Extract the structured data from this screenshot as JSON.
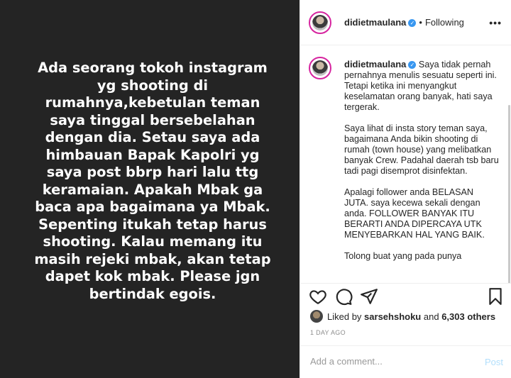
{
  "post": {
    "image_text": "Ada seorang tokoh instagram yg shooting di rumahnya,kebetulan teman saya tinggal bersebelahan dengan dia. Setau saya ada himbauan Bapak Kapolri yg saya post bbrp hari lalu ttg keramaian. Apakah Mbak ga baca apa bagaimana ya Mbak. Sepenting itukah tetap harus shooting. Kalau memang itu masih rejeki mbak, akan tetap dapet kok mbak. Please jgn bertindak egois."
  },
  "header": {
    "username": "didietmaulana",
    "separator": "•",
    "follow_status": "Following",
    "more_icon": "more-horizontal-icon"
  },
  "caption": {
    "username": "didietmaulana",
    "paragraph1": "Saya tidak pernah pernahnya menulis sesuatu seperti ini. Tetapi ketika ini menyangkut keselamatan orang banyak, hati saya tergerak.",
    "paragraph2": "Saya lihat di insta story teman saya, bagaimana Anda bikin shooting di rumah (town house) yang melibatkan banyak Crew. Padahal daerah tsb baru tadi pagi disemprot disinfektan.",
    "paragraph3": "Apalagi follower anda BELASAN JUTA. saya kecewa sekali dengan anda. FOLLOWER BANYAK ITU BERARTI ANDA DIPERCAYA UTK MENYEBARKAN HAL YANG BAIK.",
    "paragraph4": "Tolong buat yang pada punya"
  },
  "actions": {
    "like_icon": "heart-icon",
    "comment_icon": "comment-icon",
    "share_icon": "send-icon",
    "save_icon": "bookmark-icon"
  },
  "likes": {
    "prefix": "Liked by",
    "user": "sarsehshoku",
    "middle": "and",
    "others": "6,303 others"
  },
  "timestamp": "1 DAY AGO",
  "comment": {
    "placeholder": "Add a comment...",
    "post_label": "Post"
  },
  "colors": {
    "image_bg": "#242424",
    "verified": "#3897f0",
    "post_button_disabled": "#b2dffc",
    "muted": "#8e8e8e"
  }
}
